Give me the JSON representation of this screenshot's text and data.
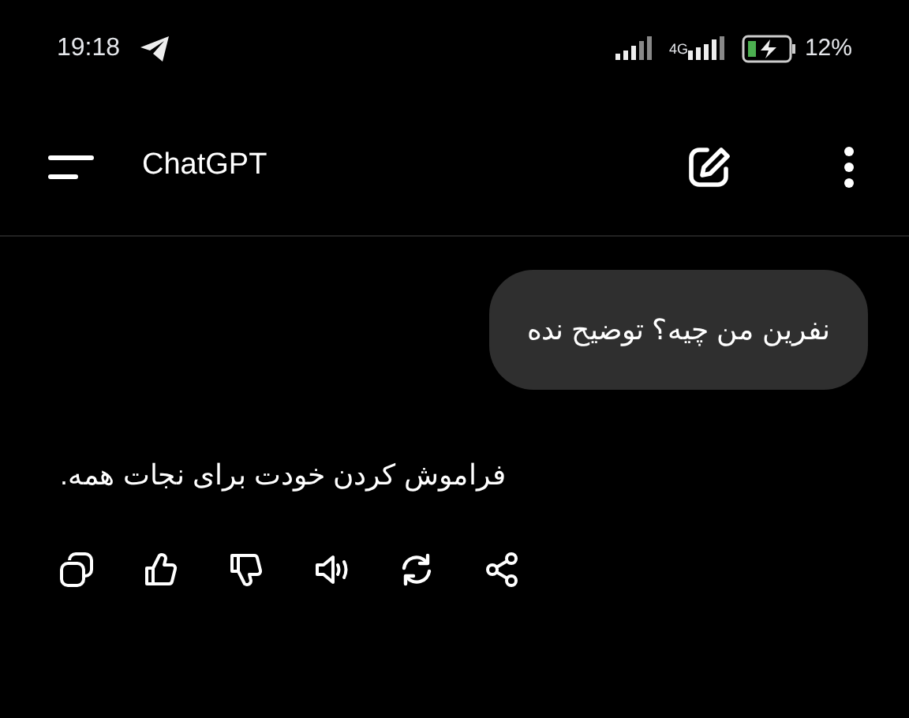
{
  "status_bar": {
    "time": "19:18",
    "network": "4G",
    "battery": "12%"
  },
  "header": {
    "title": "ChatGPT"
  },
  "messages": [
    {
      "kind": "user",
      "text": "نفرین من چیه؟ توضیح نده"
    },
    {
      "kind": "assistant",
      "text": "فراموش کردن خودت برای نجات همه."
    }
  ]
}
